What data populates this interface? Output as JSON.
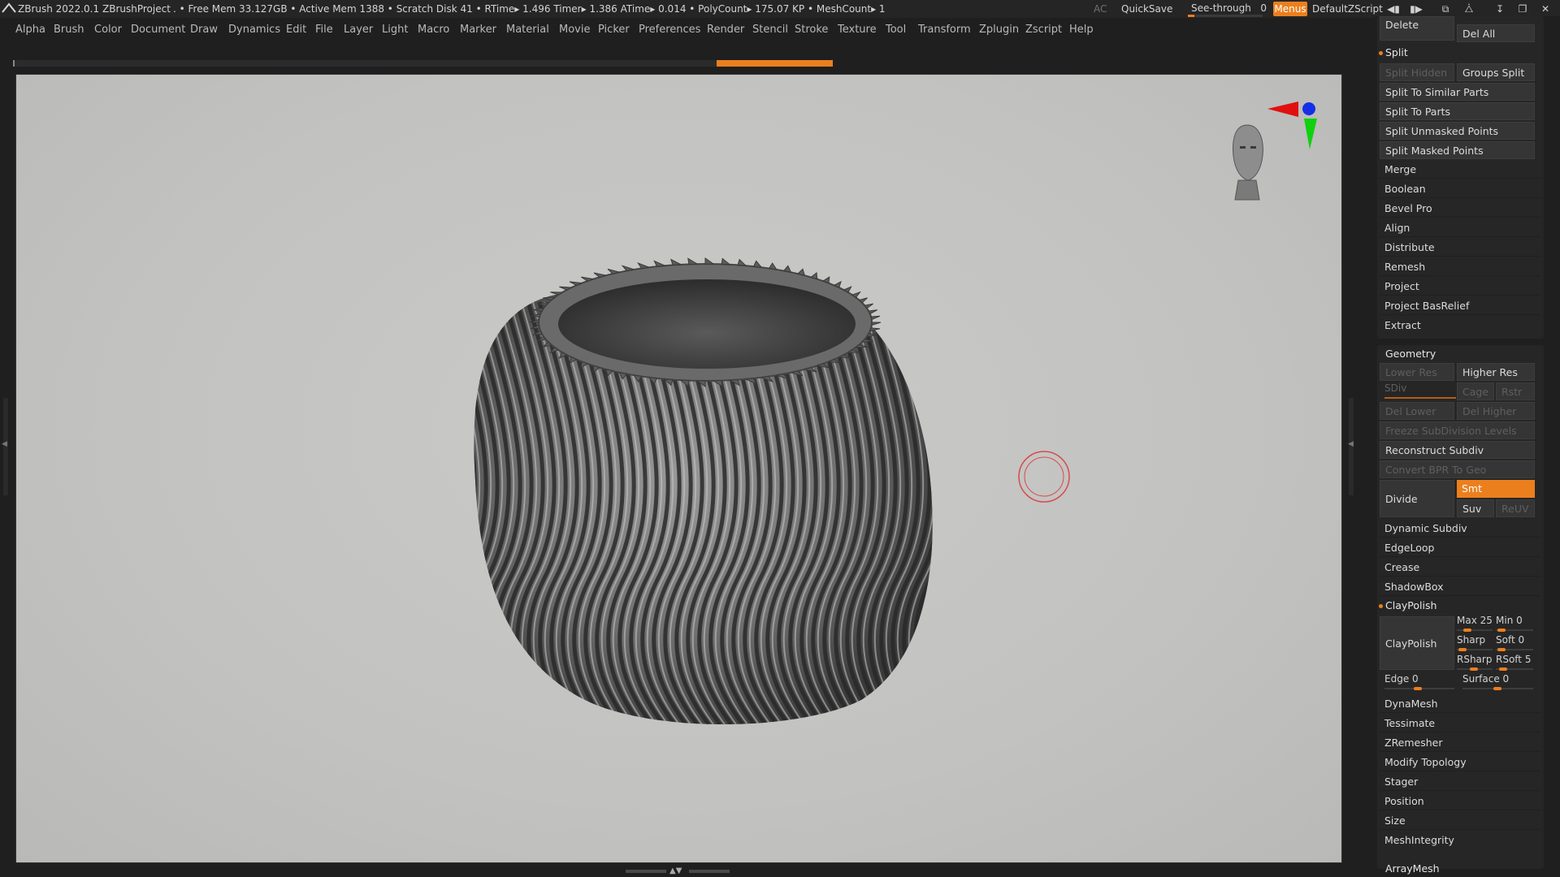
{
  "titlebar": {
    "app": "ZBrush 2022.0.1",
    "project": "ZBrushProject",
    "stats": ". • Free Mem 33.127GB • Active Mem 1388 • Scratch Disk 41 •  RTime▸ 1.496 Timer▸ 1.386 ATime▸ 0.014 • PolyCount▸ 175.07 KP  • MeshCount▸ 1",
    "ac": "AC",
    "quicksave": "QuickSave",
    "seethrough_label": "See-through",
    "seethrough_value": "0",
    "seethrough_level": 0.05,
    "menus": "Menus",
    "script": "DefaultZScript",
    "accent": "#ec7f1d"
  },
  "menubar": [
    "Alpha",
    "Brush",
    "Color",
    "Document",
    "Draw",
    "Dynamics",
    "Edit",
    "File",
    "Layer",
    "Light",
    "Macro",
    "Marker",
    "Material",
    "Movie",
    "Picker",
    "Preferences",
    "Render",
    "Stencil",
    "Stroke",
    "Texture",
    "Tool",
    "Transform",
    "Zplugin",
    "Zscript",
    "Help"
  ],
  "panel": {
    "top": {
      "delete": "Delete",
      "del_all": "Del All"
    },
    "split": {
      "header": "Split",
      "split_hidden": "Split Hidden",
      "groups_split": "Groups Split",
      "similar": "Split To Similar Parts",
      "to_parts": "Split To Parts",
      "unmasked": "Split Unmasked Points",
      "masked": "Split Masked Points"
    },
    "subtools": [
      "Merge",
      "Boolean",
      "Bevel Pro",
      "Align",
      "Distribute",
      "Remesh",
      "Project",
      "Project BasRelief",
      "Extract"
    ],
    "geometry": {
      "header": "Geometry",
      "lower_res": "Lower Res",
      "higher_res": "Higher Res",
      "sdiv": "SDiv",
      "cage": "Cage",
      "rstr": "Rstr",
      "del_lower": "Del Lower",
      "del_higher": "Del Higher",
      "freeze": "Freeze SubDivision Levels",
      "reconstruct": "Reconstruct Subdiv",
      "convert_bpr": "Convert BPR To Geo",
      "divide": "Divide",
      "smt": "Smt",
      "suv": "Suv",
      "reuv": "ReUV",
      "dynamic_subdiv": "Dynamic Subdiv",
      "edgeloop": "EdgeLoop",
      "crease": "Crease",
      "shadowbox": "ShadowBox",
      "claypolish_header": "ClayPolish",
      "claypolish_btn": "ClayPolish",
      "max": "Max 25",
      "min": "Min 0",
      "sharp": "Sharp",
      "soft": "Soft 0",
      "rsharp": "RSharp",
      "rsoft": "RSoft 5",
      "edge": "Edge 0",
      "surface": "Surface 0",
      "more": [
        "DynaMesh",
        "Tessimate",
        "ZRemesher",
        "Modify Topology",
        "Stager",
        "Position",
        "Size",
        "MeshIntegrity"
      ]
    },
    "arraymesh": "ArrayMesh"
  }
}
